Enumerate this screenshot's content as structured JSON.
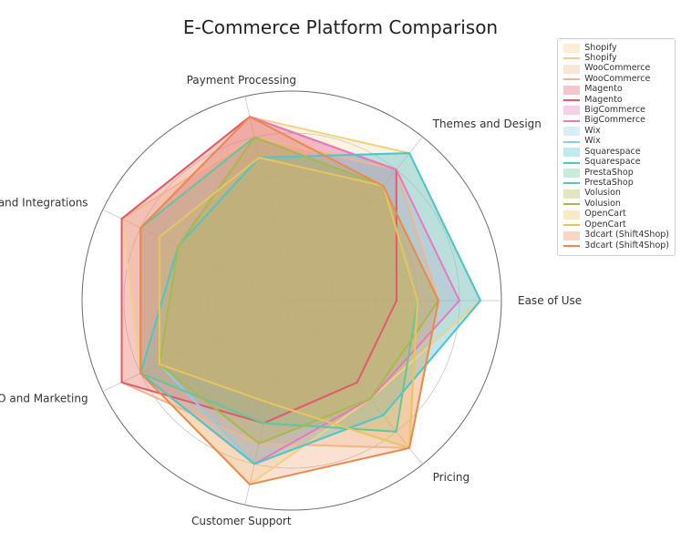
{
  "title": "E-Commerce Platform Comparison",
  "chart_data": {
    "type": "radar",
    "categories": [
      "Ease of Use",
      "Themes and Design",
      "Payment Processing",
      "Apps and Integrations",
      "SEO and Marketing",
      "Customer Support",
      "Pricing"
    ],
    "rlim": [
      0,
      10
    ],
    "grid": true,
    "legend_position": "upper-right",
    "series": [
      {
        "name": "Shopify",
        "color": "#f4cf86",
        "values": [
          9,
          9,
          9,
          9,
          8,
          9,
          6
        ]
      },
      {
        "name": "WooCommerce",
        "color": "#f2b48b",
        "values": [
          7,
          8,
          8,
          9,
          9,
          7,
          9
        ]
      },
      {
        "name": "Magento",
        "color": "#e15a6b",
        "values": [
          5,
          8,
          9,
          9,
          9,
          6,
          5
        ]
      },
      {
        "name": "BigCommerce",
        "color": "#e679c1",
        "values": [
          8,
          8,
          9,
          8,
          8,
          8,
          6
        ]
      },
      {
        "name": "Wix",
        "color": "#8fcbe6",
        "values": [
          9,
          9,
          7,
          7,
          7,
          8,
          7
        ]
      },
      {
        "name": "Squarespace",
        "color": "#4bc6c9",
        "values": [
          9,
          9,
          7,
          6,
          8,
          8,
          7
        ]
      },
      {
        "name": "PrestaShop",
        "color": "#63c69a",
        "values": [
          6,
          7,
          8,
          8,
          8,
          6,
          8
        ]
      },
      {
        "name": "Volusion",
        "color": "#a9b84a",
        "values": [
          7,
          7,
          8,
          6,
          7,
          7,
          6
        ]
      },
      {
        "name": "OpenCart",
        "color": "#e7c55d",
        "values": [
          6,
          7,
          7,
          7,
          7,
          5,
          9
        ]
      },
      {
        "name": "3dcart (Shift4Shop)",
        "color": "#e88b4d",
        "values": [
          7,
          7,
          9,
          8,
          8,
          9,
          9
        ]
      }
    ]
  }
}
